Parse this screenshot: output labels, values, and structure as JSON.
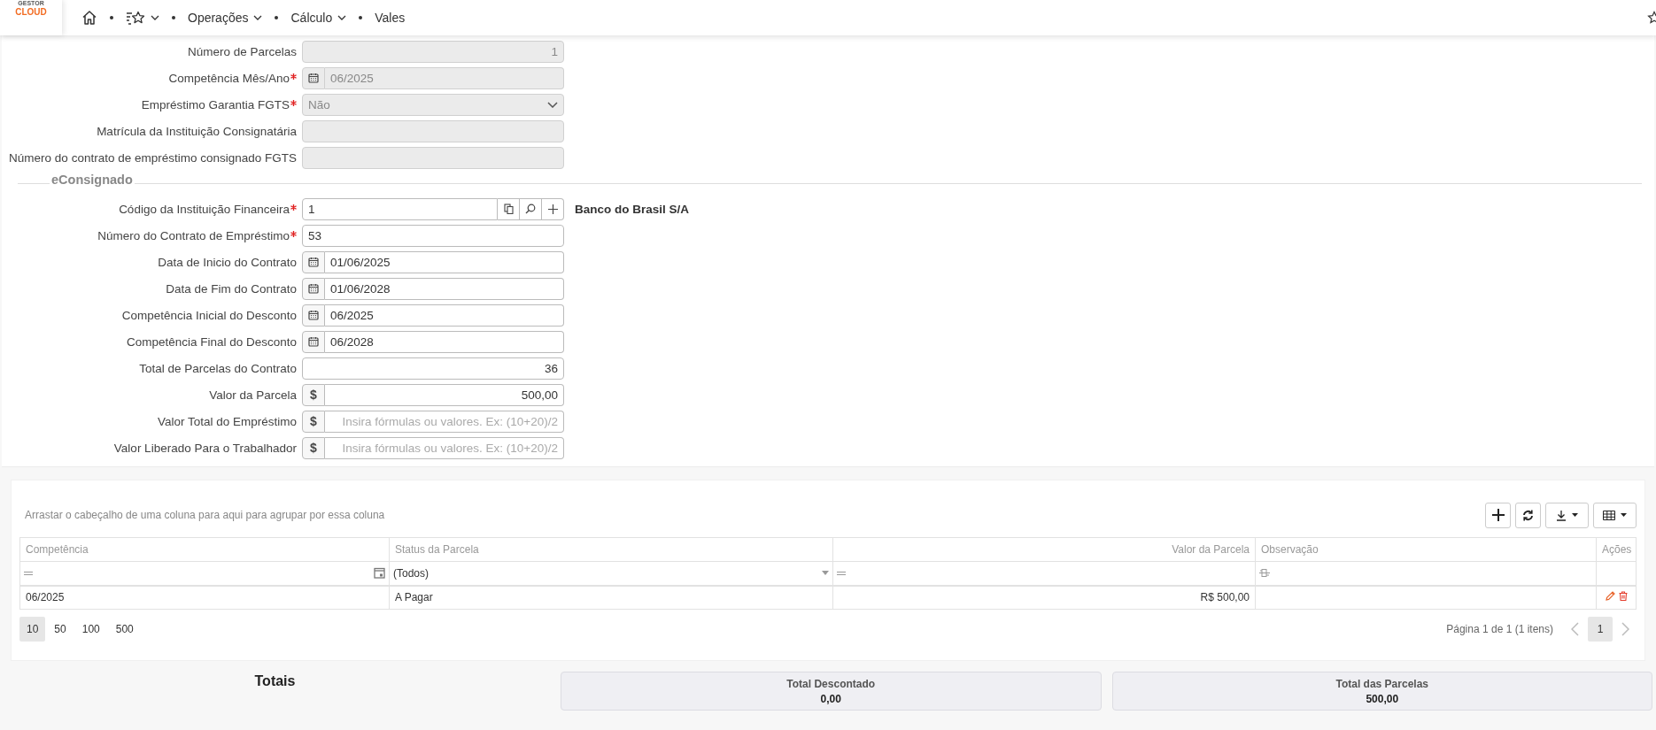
{
  "header": {
    "logo": {
      "top": "GESTOR",
      "bottom": "CLOUD"
    },
    "breadcrumb": [
      {
        "kind": "home"
      },
      {
        "kind": "favorites",
        "dropdown": true
      },
      {
        "kind": "text",
        "label": "Operações",
        "dropdown": true
      },
      {
        "kind": "text",
        "label": "Cálculo",
        "dropdown": true
      },
      {
        "kind": "text",
        "label": "Vales",
        "dropdown": false
      }
    ]
  },
  "form": {
    "fields": [
      {
        "label": "Número de Parcelas",
        "required": false,
        "kind": "number",
        "value": "1",
        "disabled": true
      },
      {
        "label": "Competência Mês/Ano",
        "required": true,
        "kind": "date",
        "value": "06/2025",
        "disabled": true
      },
      {
        "label": "Empréstimo Garantia FGTS",
        "required": true,
        "kind": "select",
        "value": "Não",
        "disabled": true
      },
      {
        "label": "Matrícula da Instituição Consignatária",
        "required": false,
        "kind": "text",
        "disabled": true
      },
      {
        "label": "Número do contrato de empréstimo consignado FGTS",
        "required": false,
        "kind": "text",
        "disabled": true
      }
    ],
    "sections": [
      {
        "title": "eConsignado",
        "fields": [
          {
            "label": "Código da Instituição Financeira",
            "required": true,
            "kind": "lookup",
            "value": "1",
            "description": "Banco do Brasil S/A",
            "disabled": false
          },
          {
            "label": "Número do Contrato de Empréstimo",
            "required": true,
            "kind": "text",
            "value": "53",
            "disabled": false
          },
          {
            "label": "Data de Inicio do Contrato",
            "required": false,
            "kind": "date",
            "value": "01/06/2025",
            "disabled": false
          },
          {
            "label": "Data de Fim do Contrato",
            "required": false,
            "kind": "date",
            "value": "01/06/2028",
            "disabled": false
          },
          {
            "label": "Competência Inicial do Desconto",
            "required": false,
            "kind": "date",
            "value": "06/2025",
            "disabled": false
          },
          {
            "label": "Competência Final do Desconto",
            "required": false,
            "kind": "date",
            "value": "06/2028",
            "disabled": false
          },
          {
            "label": "Total de Parcelas do Contrato",
            "required": false,
            "kind": "number",
            "value": "36",
            "disabled": false
          },
          {
            "label": "Valor da Parcela",
            "required": false,
            "kind": "money",
            "prefix": "$",
            "value": "500,00",
            "disabled": false
          },
          {
            "label": "Valor Total do Empréstimo",
            "required": false,
            "kind": "money",
            "prefix": "$",
            "placeholder": "Insira fórmulas ou valores. Ex: (10+20)/2",
            "disabled": false
          },
          {
            "label": "Valor Liberado Para o Trabalhador",
            "required": false,
            "kind": "money",
            "prefix": "$",
            "placeholder": "Insira fórmulas ou valores. Ex: (10+20)/2",
            "disabled": false
          }
        ]
      }
    ]
  },
  "grid": {
    "group_hint": "Arrastar o cabeçalho de uma coluna para aqui para agrupar por essa coluna",
    "columns": [
      {
        "label": "Competência",
        "kind": "date"
      },
      {
        "label": "Status da Parcela",
        "kind": "select",
        "filter_value": "(Todos)"
      },
      {
        "label": "Valor da Parcela",
        "kind": "number"
      },
      {
        "label": "Observação",
        "kind": "text"
      },
      {
        "label": "Ações",
        "kind": "actions"
      }
    ],
    "rows": [
      {
        "cells": [
          "06/2025",
          "A Pagar",
          "R$ 500,00"
        ],
        "actions": [
          {
            "kind": "edit"
          },
          {
            "kind": "delete"
          }
        ]
      }
    ],
    "page_sizes": [
      {
        "label": "10",
        "selected": true
      },
      {
        "label": "50",
        "selected": false
      },
      {
        "label": "100",
        "selected": false
      },
      {
        "label": "500",
        "selected": false
      }
    ],
    "page_info": "Página 1 de 1 (1 itens)",
    "pages": [
      {
        "label": "1",
        "selected": true
      }
    ]
  },
  "totals": {
    "title": "Totais",
    "items": [
      {
        "label": "Total Descontado",
        "value": "0,00"
      },
      {
        "label": "Total das Parcelas",
        "value": "500,00"
      }
    ]
  }
}
